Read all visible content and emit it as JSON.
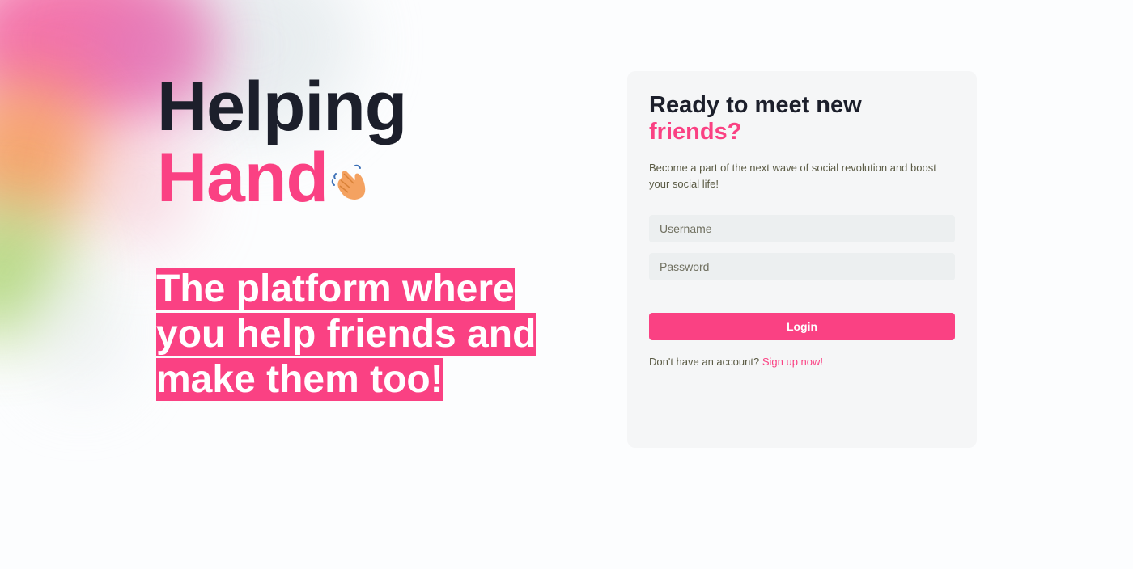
{
  "brand": {
    "line1": "Helping",
    "line2": "Hand",
    "icon": "waving-hand-icon",
    "dark_color": "#1c1f2b",
    "accent_color": "#fa4183"
  },
  "tagline": "The platform where you help friends and make them too!",
  "login_card": {
    "title_line1": "Ready to meet new",
    "title_line2": "friends?",
    "subtitle": "Become a part of the next wave of social revolution and boost your social life!",
    "username_placeholder": "Username",
    "password_placeholder": "Password",
    "login_label": "Login",
    "signup_prompt": "Don't have an account?",
    "signup_link": "Sign up now!"
  }
}
